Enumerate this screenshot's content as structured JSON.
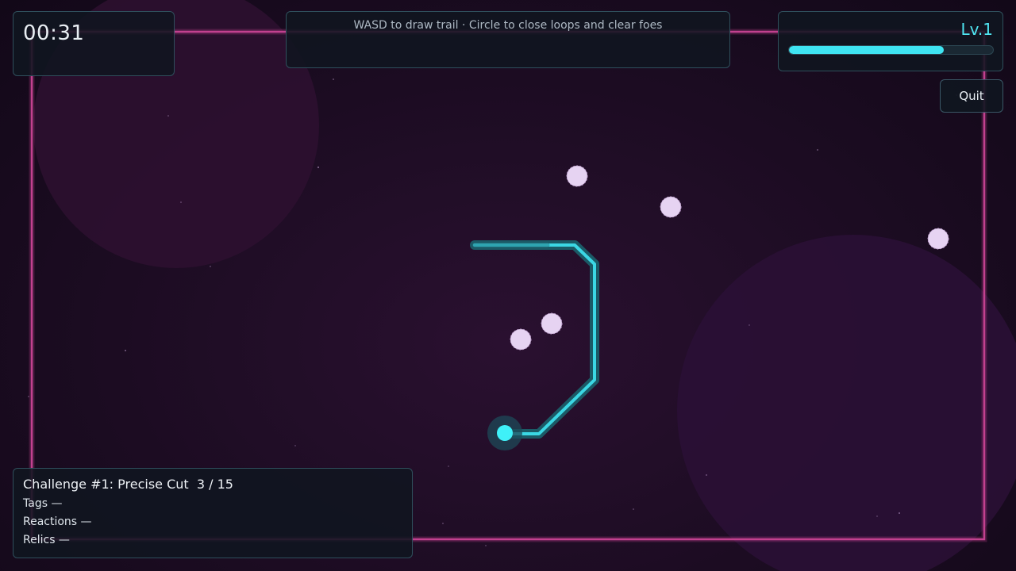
{
  "hud": {
    "timer": "00:31",
    "hint": "WASD to draw trail · Circle to close loops and clear foes",
    "level_label": "Lv.1",
    "xp_progress": 0.76,
    "quit_label": "Quit"
  },
  "challenge": {
    "title": "Challenge #1: Precise Cut",
    "progress_text": "3 / 15",
    "tags_line": "Tags —",
    "reactions_line": "Reactions —",
    "relics_line": "Relics —"
  },
  "colors": {
    "arena_border": "#c2418f",
    "trail": "#3fe4f2",
    "trail_glow": "#1b5a66",
    "player": "#3ff0f8",
    "enemy": "#e6d3f2",
    "xp_fill": "#3fe4f2",
    "level_text": "#4fe6f2"
  },
  "icons": {
    "player": "player-orb-icon",
    "enemy": "enemy-orb-icon"
  },
  "entities": {
    "enemy_count": 5
  }
}
